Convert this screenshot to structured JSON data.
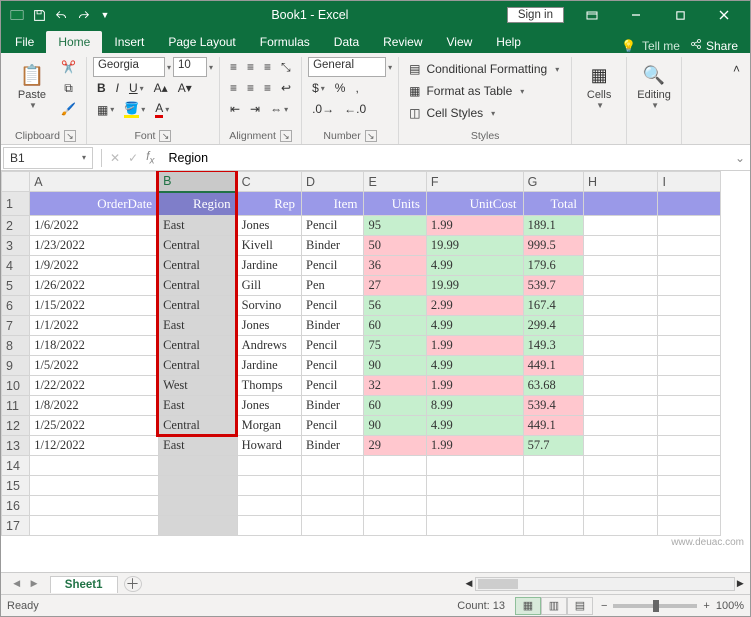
{
  "titlebar": {
    "doc_name": "Book1  -  Excel",
    "signin": "Sign in"
  },
  "tabs": {
    "file": "File",
    "home": "Home",
    "insert": "Insert",
    "page_layout": "Page Layout",
    "formulas": "Formulas",
    "data": "Data",
    "review": "Review",
    "view": "View",
    "help": "Help",
    "tell_me": "Tell me",
    "share": "Share"
  },
  "ribbon": {
    "clipboard": {
      "label": "Clipboard",
      "paste": "Paste"
    },
    "font": {
      "label": "Font",
      "name": "Georgia",
      "size": "10"
    },
    "alignment": {
      "label": "Alignment"
    },
    "number": {
      "label": "Number",
      "format": "General"
    },
    "styles": {
      "label": "Styles",
      "cond_fmt": "Conditional Formatting",
      "as_table": "Format as Table",
      "cell_styles": "Cell Styles"
    },
    "cells": {
      "label": "Cells"
    },
    "editing": {
      "label": "Editing"
    }
  },
  "formula_bar": {
    "name_box": "B1",
    "formula": "Region"
  },
  "columns": [
    "A",
    "B",
    "C",
    "D",
    "E",
    "F",
    "G",
    "H",
    "I"
  ],
  "row_numbers": [
    1,
    2,
    3,
    4,
    5,
    6,
    7,
    8,
    9,
    10,
    11,
    12,
    13,
    14,
    15,
    16,
    17
  ],
  "headers": {
    "A": "OrderDate",
    "B": "Region",
    "C": "Rep",
    "D": "Item",
    "E": "Units",
    "F": "UnitCost",
    "G": "Total"
  },
  "rows": [
    {
      "date": "1/6/2022",
      "region": "East",
      "rep": "Jones",
      "item": "Pencil",
      "units": "95",
      "units_c": "green",
      "cost": "1.99",
      "cost_c": "pink",
      "total": "189.1",
      "total_c": "green"
    },
    {
      "date": "1/23/2022",
      "region": "Central",
      "rep": "Kivell",
      "item": "Binder",
      "units": "50",
      "units_c": "pink",
      "cost": "19.99",
      "cost_c": "green",
      "total": "999.5",
      "total_c": "pink"
    },
    {
      "date": "1/9/2022",
      "region": "Central",
      "rep": "Jardine",
      "item": "Pencil",
      "units": "36",
      "units_c": "pink",
      "cost": "4.99",
      "cost_c": "green",
      "total": "179.6",
      "total_c": "green"
    },
    {
      "date": "1/26/2022",
      "region": "Central",
      "rep": "Gill",
      "item": "Pen",
      "units": "27",
      "units_c": "pink",
      "cost": "19.99",
      "cost_c": "green",
      "total": "539.7",
      "total_c": "pink"
    },
    {
      "date": "1/15/2022",
      "region": "Central",
      "rep": "Sorvino",
      "item": "Pencil",
      "units": "56",
      "units_c": "green",
      "cost": "2.99",
      "cost_c": "pink",
      "total": "167.4",
      "total_c": "green"
    },
    {
      "date": "1/1/2022",
      "region": "East",
      "rep": "Jones",
      "item": "Binder",
      "units": "60",
      "units_c": "green",
      "cost": "4.99",
      "cost_c": "green",
      "total": "299.4",
      "total_c": "green"
    },
    {
      "date": "1/18/2022",
      "region": "Central",
      "rep": "Andrews",
      "item": "Pencil",
      "units": "75",
      "units_c": "green",
      "cost": "1.99",
      "cost_c": "pink",
      "total": "149.3",
      "total_c": "green"
    },
    {
      "date": "1/5/2022",
      "region": "Central",
      "rep": "Jardine",
      "item": "Pencil",
      "units": "90",
      "units_c": "green",
      "cost": "4.99",
      "cost_c": "green",
      "total": "449.1",
      "total_c": "pink"
    },
    {
      "date": "1/22/2022",
      "region": "West",
      "rep": "Thomps",
      "item": "Pencil",
      "units": "32",
      "units_c": "pink",
      "cost": "1.99",
      "cost_c": "pink",
      "total": "63.68",
      "total_c": "green"
    },
    {
      "date": "1/8/2022",
      "region": "East",
      "rep": "Jones",
      "item": "Binder",
      "units": "60",
      "units_c": "green",
      "cost": "8.99",
      "cost_c": "green",
      "total": "539.4",
      "total_c": "pink"
    },
    {
      "date": "1/25/2022",
      "region": "Central",
      "rep": "Morgan",
      "item": "Pencil",
      "units": "90",
      "units_c": "green",
      "cost": "4.99",
      "cost_c": "green",
      "total": "449.1",
      "total_c": "pink"
    },
    {
      "date": "1/12/2022",
      "region": "East",
      "rep": "Howard",
      "item": "Binder",
      "units": "29",
      "units_c": "pink",
      "cost": "1.99",
      "cost_c": "pink",
      "total": "57.7",
      "total_c": "green"
    }
  ],
  "sheet_tabs": {
    "sheet1": "Sheet1"
  },
  "statusbar": {
    "ready": "Ready",
    "count": "Count: 13",
    "zoom": "100%"
  },
  "watermark": "www.deuac.com"
}
